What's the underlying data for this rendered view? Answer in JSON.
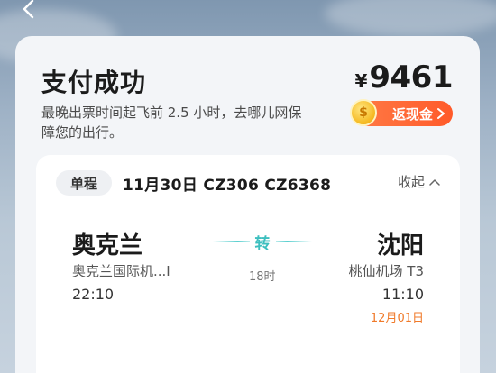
{
  "header": {
    "back_icon": "chevron-left-icon"
  },
  "summary": {
    "title": "支付成功",
    "description": "最晚出票时间起飞前 2.5 小时，去哪儿网保障您的出行。",
    "currency": "¥",
    "amount": "9461",
    "cashback_label": "返现金",
    "cashback_icon": "coin-icon",
    "coin_glyph": "$"
  },
  "flight": {
    "trip_type": "单程",
    "info": "11月30日 CZ306 CZ6368",
    "collapse_label": "收起",
    "departure": {
      "city": "奥克兰",
      "airport": "奥克兰国际机...I",
      "time": "22:10"
    },
    "transfer_label": "转",
    "duration": "18时",
    "arrival": {
      "city": "沈阳",
      "airport": "桃仙机场 T3",
      "time": "11:10",
      "date": "12月01日"
    }
  },
  "colors": {
    "accent_orange": "#ff5a2a",
    "transfer_teal": "#3dbfbf",
    "date_orange": "#f07a2a"
  }
}
